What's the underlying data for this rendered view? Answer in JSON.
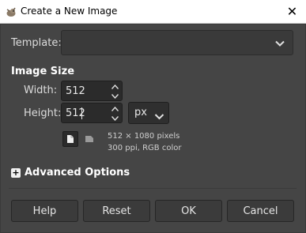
{
  "window": {
    "title": "Create a New Image",
    "close_glyph": "✕"
  },
  "template": {
    "label": "Template:",
    "value": ""
  },
  "image_size": {
    "section_title": "Image Size",
    "width_label": "Width:",
    "width_value": "512",
    "height_label": "Height:",
    "height_value": "512",
    "unit": "px"
  },
  "info": {
    "pixels": "512 × 1080 pixels",
    "resolution": "300 ppi, RGB color"
  },
  "advanced": {
    "label": "Advanced Options",
    "expander_glyph": "+"
  },
  "buttons": {
    "help": "Help",
    "reset": "Reset",
    "ok": "OK",
    "cancel": "Cancel"
  }
}
